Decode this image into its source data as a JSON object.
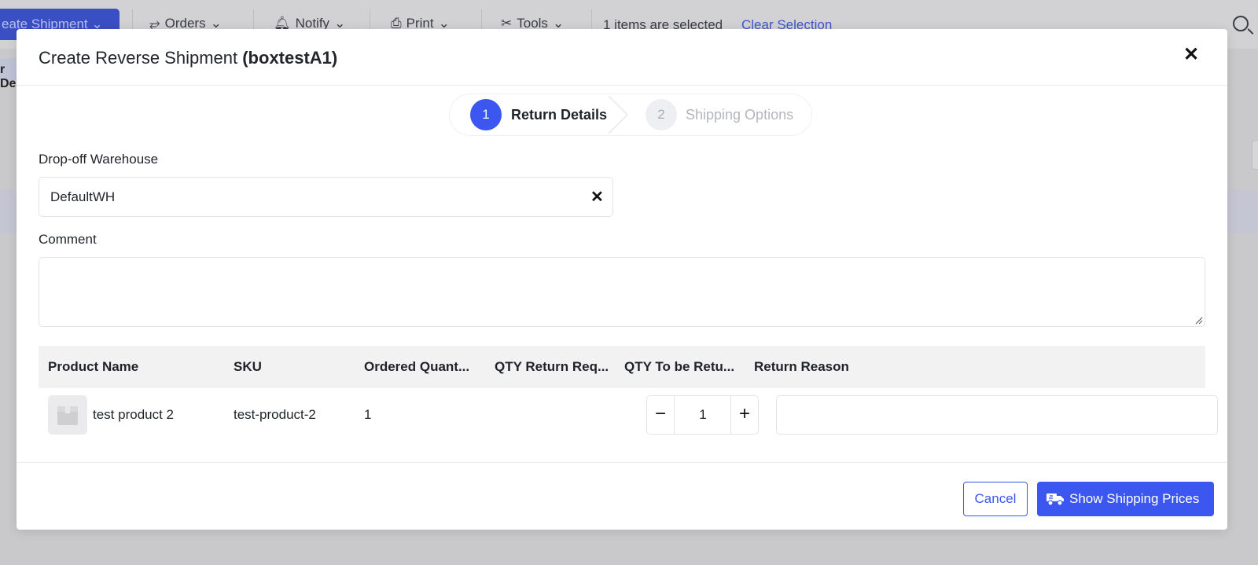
{
  "background": {
    "create_button": "eate Shipment",
    "menus": [
      {
        "label": "Orders",
        "icon": "orders-icon"
      },
      {
        "label": "Notify",
        "icon": "bell-icon"
      },
      {
        "label": "Print",
        "icon": "printer-icon"
      },
      {
        "label": "Tools",
        "icon": "tools-icon"
      }
    ],
    "selection_text": "1 items are selected",
    "clear_selection": "Clear Selection",
    "strip_label": "r De"
  },
  "modal": {
    "title_prefix": "Create Reverse Shipment ",
    "title_order": "(boxtestA1)",
    "steps": [
      {
        "number": "1",
        "label": "Return Details",
        "active": true
      },
      {
        "number": "2",
        "label": "Shipping Options",
        "active": false
      }
    ],
    "warehouse_label": "Drop-off Warehouse",
    "warehouse_value": "DefaultWH",
    "comment_label": "Comment",
    "comment_value": "",
    "table": {
      "headers": [
        "Product Name",
        "SKU",
        "Ordered Quant...",
        "QTY Return Req...",
        "QTY To be Retu...",
        "Return Reason"
      ],
      "rows": [
        {
          "product_name": "test product 2",
          "sku": "test-product-2",
          "ordered_qty": "1",
          "qty_return_requested": "",
          "qty_to_be_returned": "1",
          "return_reason": ""
        }
      ]
    },
    "cancel_label": "Cancel",
    "primary_label": "Show Shipping Prices",
    "primary_icon": "truck-icon",
    "accent_color": "#3b57f0"
  }
}
